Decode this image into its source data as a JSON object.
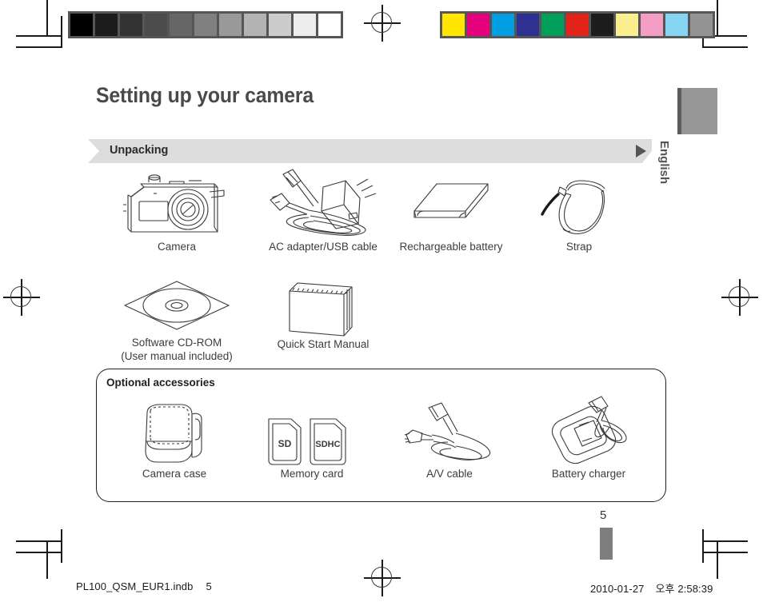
{
  "document": {
    "title": "Setting up your camera",
    "section": "Unpacking",
    "language_tab": "English",
    "page_number": "5"
  },
  "included_items": [
    {
      "caption": "Camera",
      "icon": "camera-icon"
    },
    {
      "caption": "AC adapter/USB cable",
      "icon": "ac-adapter-usb-cable-icon"
    },
    {
      "caption": "Rechargeable battery",
      "icon": "battery-icon"
    },
    {
      "caption": "Strap",
      "icon": "strap-icon"
    },
    {
      "caption": "Software CD-ROM",
      "caption_line2": "(User manual included)",
      "icon": "cd-rom-icon"
    },
    {
      "caption": "Quick Start Manual",
      "icon": "manual-booklet-icon"
    }
  ],
  "optional": {
    "title": "Optional accessories",
    "items": [
      {
        "caption": "Camera case",
        "icon": "camera-case-icon"
      },
      {
        "caption": "Memory card",
        "icon": "memory-card-icon",
        "card_labels": [
          "SD",
          "SDHC"
        ]
      },
      {
        "caption": "A/V cable",
        "icon": "av-cable-icon"
      },
      {
        "caption": "Battery charger",
        "icon": "battery-charger-icon"
      }
    ]
  },
  "footer": {
    "file_name": "PL100_QSM_EUR1.indb",
    "file_page": "5",
    "date": "2010-01-27",
    "time": "오후 2:58:39"
  },
  "calibration": {
    "grayscale": [
      "#000000",
      "#1c1c1c",
      "#333333",
      "#4c4c4c",
      "#666666",
      "#808080",
      "#999999",
      "#b3b3b3",
      "#cccccc",
      "#ededed",
      "#ffffff"
    ],
    "colors": [
      "#ffe500",
      "#e6007e",
      "#009fe3",
      "#2e3192",
      "#00a05a",
      "#e2231a",
      "#1d1d1b",
      "#faef8c",
      "#f39dc5",
      "#85d4f2",
      "#939393"
    ]
  },
  "theme": {
    "banner_bg": "#dddddd",
    "tab_gray": "#969696",
    "ink": "#3c3c3c"
  }
}
